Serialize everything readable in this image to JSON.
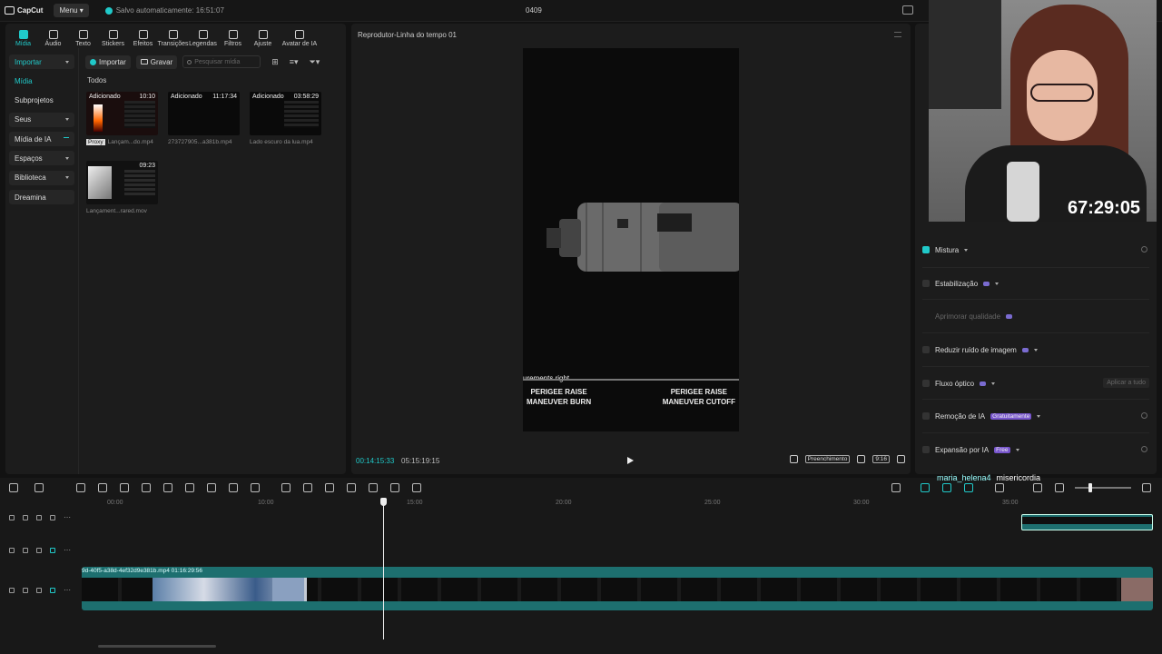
{
  "titlebar": {
    "menu_label": "Menu",
    "saved_text": "Salvo automaticamente: 16:51:07",
    "project_name": "0409"
  },
  "tools": [
    {
      "label": "Mídia",
      "active": true
    },
    {
      "label": "Áudio"
    },
    {
      "label": "Texto"
    },
    {
      "label": "Stickers"
    },
    {
      "label": "Efeitos"
    },
    {
      "label": "Transições"
    },
    {
      "label": "Legendas"
    },
    {
      "label": "Filtros"
    },
    {
      "label": "Ajuste"
    },
    {
      "label": "Avatar de IA"
    }
  ],
  "sidebar": {
    "items": [
      {
        "label": "Importar"
      },
      {
        "label": "Mídia"
      },
      {
        "label": "Subprojetos"
      },
      {
        "label": "Seus"
      },
      {
        "label": "Mídia de IA"
      },
      {
        "label": "Espaços"
      },
      {
        "label": "Biblioteca"
      },
      {
        "label": "Dreamina"
      }
    ]
  },
  "media": {
    "import_label": "Importar",
    "record_label": "Gravar",
    "search_placeholder": "Pesquisar mídia",
    "section": "Todos",
    "clips": [
      {
        "tag": "Adicionado",
        "duration": "10:10",
        "name": "Lançam...do.mp4",
        "proxy": "Proxy"
      },
      {
        "tag": "Adicionado",
        "duration": "11:17:34",
        "name": "273727905...a381b.mp4"
      },
      {
        "tag": "Adicionado",
        "duration": "03:58:29",
        "name": "Lado escuro da lua.mp4"
      },
      {
        "tag": "",
        "duration": "09:23",
        "name": "Lançament...rared.mov"
      }
    ]
  },
  "player": {
    "title": "Reprodutor-Linha do tempo 01",
    "caption_top": "urements right",
    "label_left": "PERIGEE RAISE\nMANEUVER BURN",
    "label_right": "PERIGEE RAISE\nMANEUVER CUTOFF",
    "time_current": "00:14:15:33",
    "time_total": "05:15:19:15",
    "fill_label": "Preenchimento",
    "ratio_label": "9:16"
  },
  "properties": {
    "mixture": "Mistura",
    "stabilization": "Estabilização",
    "enhance": "Aprimorar qualidade",
    "noise": "Reduzir ruído de imagem",
    "optical": "Fluxo óptico",
    "apply_all": "Aplicar a tudo",
    "ai_removal": "Remoção de IA",
    "ai_removal_badge": "Gratuitamente",
    "ai_expand": "Expansão por IA",
    "ai_expand_badge": "Free"
  },
  "overlay": {
    "timer": "67:29:05",
    "chat_user": "maria_helena4",
    "chat_message": "misericordia"
  },
  "timeline": {
    "ticks": [
      "00:00",
      "10:00",
      "15:00",
      "20:00",
      "25:00",
      "30:00",
      "35:00"
    ],
    "main_clip_label": "9d-40f5-a38d-4ef32d9e381b.mp4   01:16:29:56"
  },
  "colors": {
    "accent": "#20c9c9",
    "badge": "#7755cc"
  }
}
